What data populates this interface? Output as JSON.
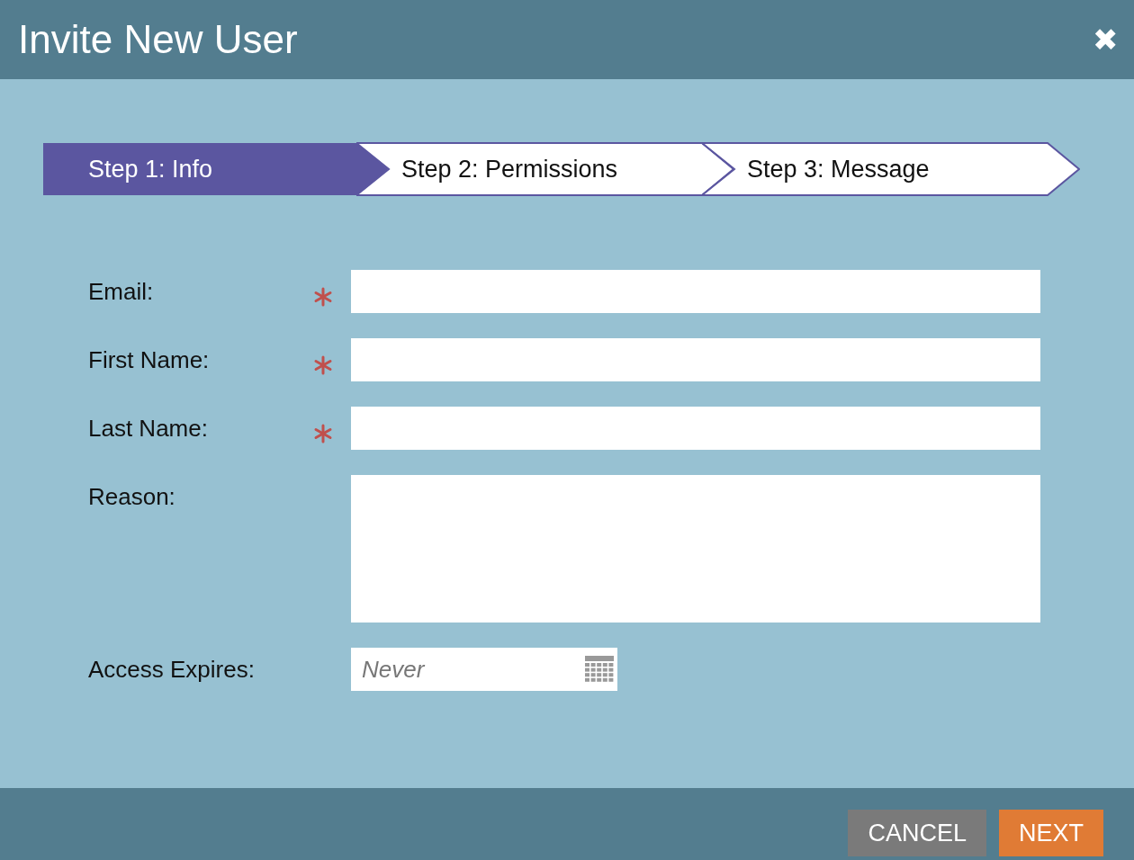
{
  "window": {
    "title": "Invite New User",
    "close": "✖"
  },
  "steps": [
    {
      "label": "Step 1: Info",
      "selected": true
    },
    {
      "label": "Step 2: Permissions",
      "selected": false
    },
    {
      "label": "Step 3: Message",
      "selected": false
    }
  ],
  "fields": [
    {
      "kind": "text",
      "label": "Email:",
      "required": true
    },
    {
      "kind": "text",
      "label": "First Name:",
      "required": true
    },
    {
      "kind": "text",
      "label": "Last Name:",
      "required": true
    },
    {
      "kind": "textarea",
      "label": "Reason:",
      "required": false
    },
    {
      "kind": "date",
      "label": "Access Expires:",
      "required": false,
      "placeholder": "Never"
    }
  ],
  "buttons": [
    {
      "kind": "secondary",
      "label": "CANCEL"
    },
    {
      "kind": "primary",
      "label": "NEXT"
    }
  ]
}
